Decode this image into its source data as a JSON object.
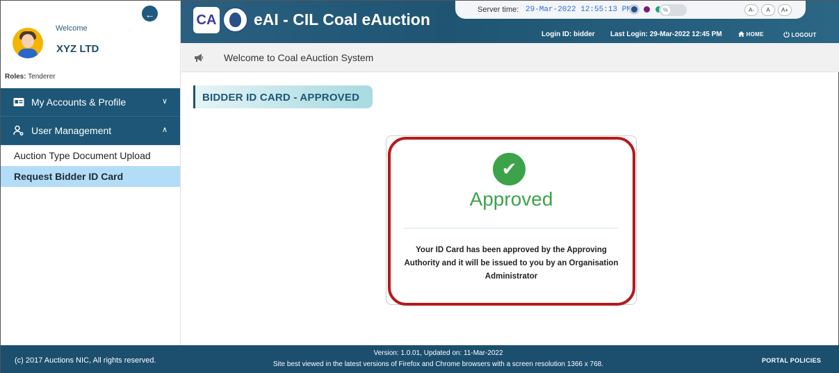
{
  "sidebar": {
    "welcome": "Welcome",
    "company": "XYZ LTD",
    "roles_label": "Roles:",
    "roles_value": "Tenderer",
    "collapse_glyph": "←",
    "menu": [
      {
        "label": "My Accounts & Profile",
        "icon": "id-card-icon",
        "chevron": "∨"
      },
      {
        "label": "User Management",
        "icon": "user-settings-icon",
        "chevron": "∧"
      }
    ],
    "sub_items": [
      {
        "label": "Auction Type Document Upload",
        "active": false
      },
      {
        "label": "Request Bidder ID Card",
        "active": true
      }
    ]
  },
  "header": {
    "logo_text": "CA",
    "title": "eAI - CIL Coal eAuction",
    "server_label": "Server time:",
    "server_time": "29-Mar-2022 12:55:13 PM",
    "theme_colors": [
      "#2a4f8a",
      "#7a1c7a",
      "#1aa37a"
    ],
    "contrast_icon": "%",
    "font_sizes": [
      "A-",
      "A",
      "A+"
    ],
    "login_id_label": "Login ID:",
    "login_id": "bidder",
    "last_login_label": "Last Login:",
    "last_login": "29-Mar-2022 12:45 PM",
    "home_label": "HOME",
    "logout_label": "LOGOUT"
  },
  "welcome_bar": {
    "text": "Welcome to Coal eAuction System"
  },
  "main": {
    "section_title": "BIDDER ID CARD - APPROVED",
    "status": "Approved",
    "check_glyph": "✔",
    "message": "Your ID Card has been approved by the Approving Authority and it will be issued to you by an Organisation Administrator"
  },
  "footer": {
    "copyright": "(c) 2017 Auctions NIC, All rights reserved.",
    "version": "Version: 1.0.01, Updated on: 11-Mar-2022",
    "best_view": "Site best viewed in the latest versions of Firefox and Chrome browsers with a screen resolution 1366 x 768.",
    "policies": "PORTAL POLICIES"
  },
  "colors": {
    "primary": "#1d5676",
    "active_bg": "#b3dcf7",
    "success": "#3ca34a",
    "highlight": "#b51a1a"
  }
}
